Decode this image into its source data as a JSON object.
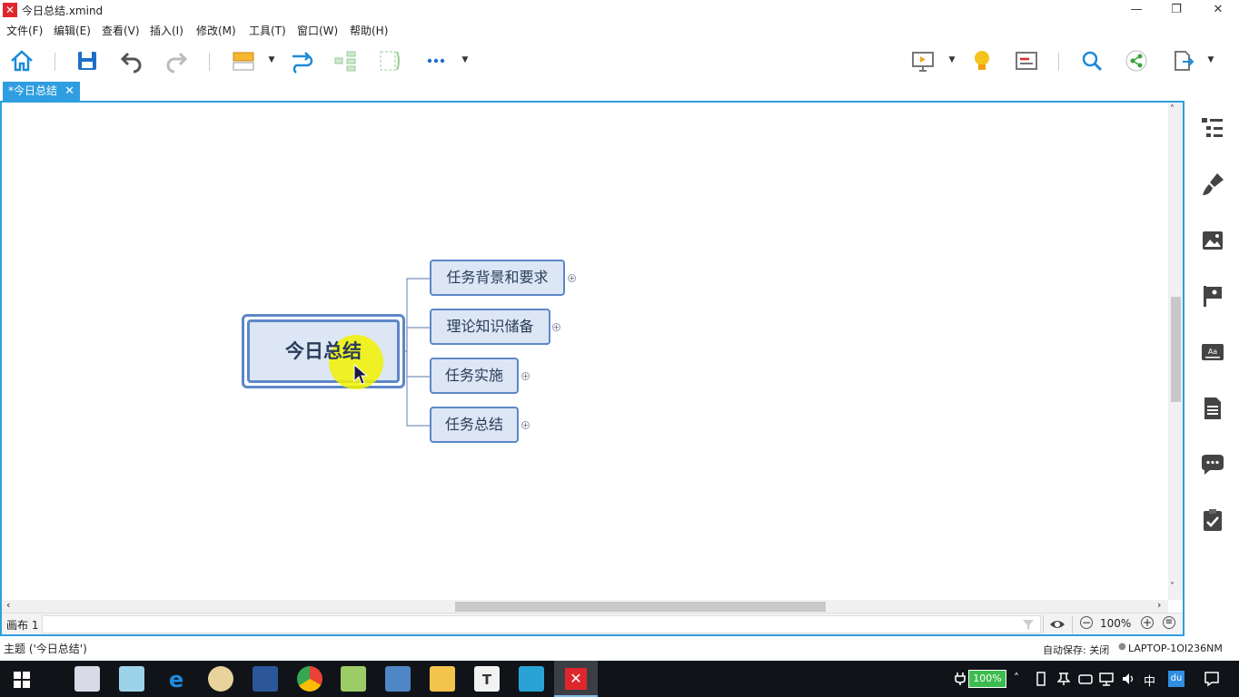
{
  "window": {
    "title": "今日总结.xmind",
    "app_icon": "xmind-logo",
    "controls": {
      "minimize": "—",
      "restore": "❐",
      "close": "✕"
    }
  },
  "menu": [
    {
      "label": "文件(F)"
    },
    {
      "label": "编辑(E)"
    },
    {
      "label": "查看(V)"
    },
    {
      "label": "插入(I)"
    },
    {
      "label": "修改(M)"
    },
    {
      "label": "工具(T)"
    },
    {
      "label": "窗口(W)"
    },
    {
      "label": "帮助(H)"
    }
  ],
  "toolbar": {
    "left": [
      "home-icon",
      "save-icon",
      "undo-icon",
      "redo-icon",
      "insert-topic-icon",
      "relationship-icon",
      "structure-icon",
      "boundary-icon",
      "more-icon"
    ],
    "right": [
      "presentation-icon",
      "idea-lightbulb-icon",
      "gantt-icon",
      "search-icon",
      "share-icon",
      "export-icon"
    ]
  },
  "tab": {
    "label": "*今日总结",
    "close": "✕"
  },
  "mindmap": {
    "central": "今日总结",
    "branches": [
      {
        "label": "任务背景和要求"
      },
      {
        "label": "理论知识储备"
      },
      {
        "label": "任务实施"
      },
      {
        "label": "任务总结"
      }
    ],
    "expand_symbol": "+"
  },
  "sheetbar": {
    "sheet": "画布 1",
    "zoom": "100%",
    "zoom_out": "−",
    "zoom_in": "+",
    "fit": "≡"
  },
  "right_panel": [
    "outline-icon",
    "format-brush-icon",
    "image-icon",
    "marker-flag-icon",
    "text-style-icon",
    "notes-icon",
    "comments-icon",
    "task-checklist-icon"
  ],
  "status": {
    "left": "主题 ('今日总结')",
    "autosave": "自动保存: 关闭",
    "machine": "LAPTOP-1OI236NM"
  },
  "taskbar": {
    "tray": {
      "battery": "100%",
      "ime": "中",
      "baidu": "du"
    }
  },
  "colors": {
    "accent": "#2f9ee0",
    "topic_fill": "#dce6f4",
    "topic_border": "#5d87c8",
    "highlight": "#f2f200",
    "xmind_red": "#e0262d"
  }
}
